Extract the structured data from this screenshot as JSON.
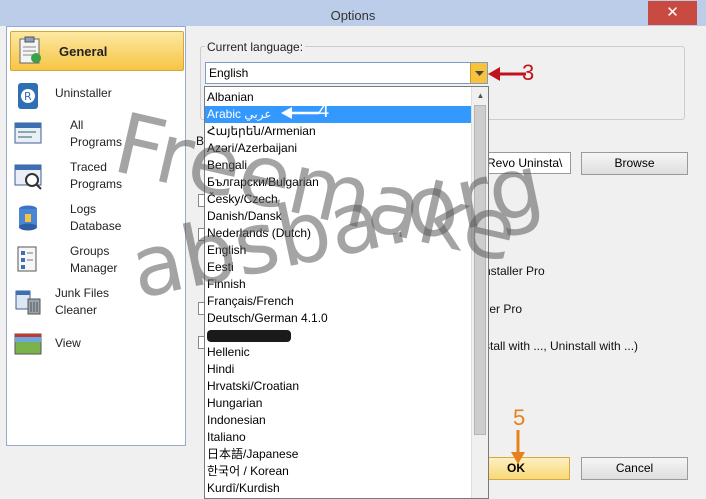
{
  "window": {
    "title": "Options",
    "close_glyph": "✕"
  },
  "sidebar": {
    "items": [
      {
        "label": "General",
        "icon": "general-settings-icon"
      },
      {
        "label": "Uninstaller",
        "icon": "uninstaller-icon"
      },
      {
        "label": "All\nPrograms",
        "icon": "all-programs-icon"
      },
      {
        "label": "Traced\nPrograms",
        "icon": "traced-programs-icon"
      },
      {
        "label": "Logs\nDatabase",
        "icon": "logs-database-icon"
      },
      {
        "label": "Groups\nManager",
        "icon": "groups-manager-icon"
      },
      {
        "label": "Junk Files\nCleaner",
        "icon": "junk-files-icon"
      },
      {
        "label": "View",
        "icon": "view-icon"
      }
    ]
  },
  "language": {
    "group_label": "Current language:",
    "selected": "English",
    "options": [
      "Albanian",
      "Arabic عربي",
      "Հայերեն/Armenian",
      "Azəri/Azerbaijani",
      "Bengali",
      "Български/Bulgarian",
      "Česky/Czech",
      "Danish/Dansk",
      "Nederlands (Dutch)",
      "English",
      "Eesti",
      "Finnish",
      "Français/French",
      "Deutsch/German 4.1.0",
      "",
      "Hellenic",
      "Hindi",
      "Hrvatski/Croatian",
      "Hungarian",
      "Indonesian",
      "Italiano",
      "日本語/Japanese",
      "한국어 / Korean",
      "Kurdî/Kurdish"
    ],
    "highlighted": "Arabic عربي"
  },
  "install_path": {
    "value": "\\Revo Uninsta",
    "label_fragment": "B"
  },
  "buttons": {
    "browse": "Browse",
    "ok": "OK",
    "cancel": "Cancel"
  },
  "options_text": {
    "opt1": "nstaller Pro",
    "opt2": "ller Pro",
    "opt3": "stall with ..., Uninstall with ...)"
  },
  "annotations": {
    "n3": "3",
    "n4": "4",
    "n5": "5",
    "arrow_color": "#c0141c",
    "orange": "#e8801c"
  },
  "watermark": {
    "line1": "Freemake",
    "line2": "absba.org"
  },
  "colors": {
    "selection": "#3399ff",
    "accent": "#f6c544"
  }
}
